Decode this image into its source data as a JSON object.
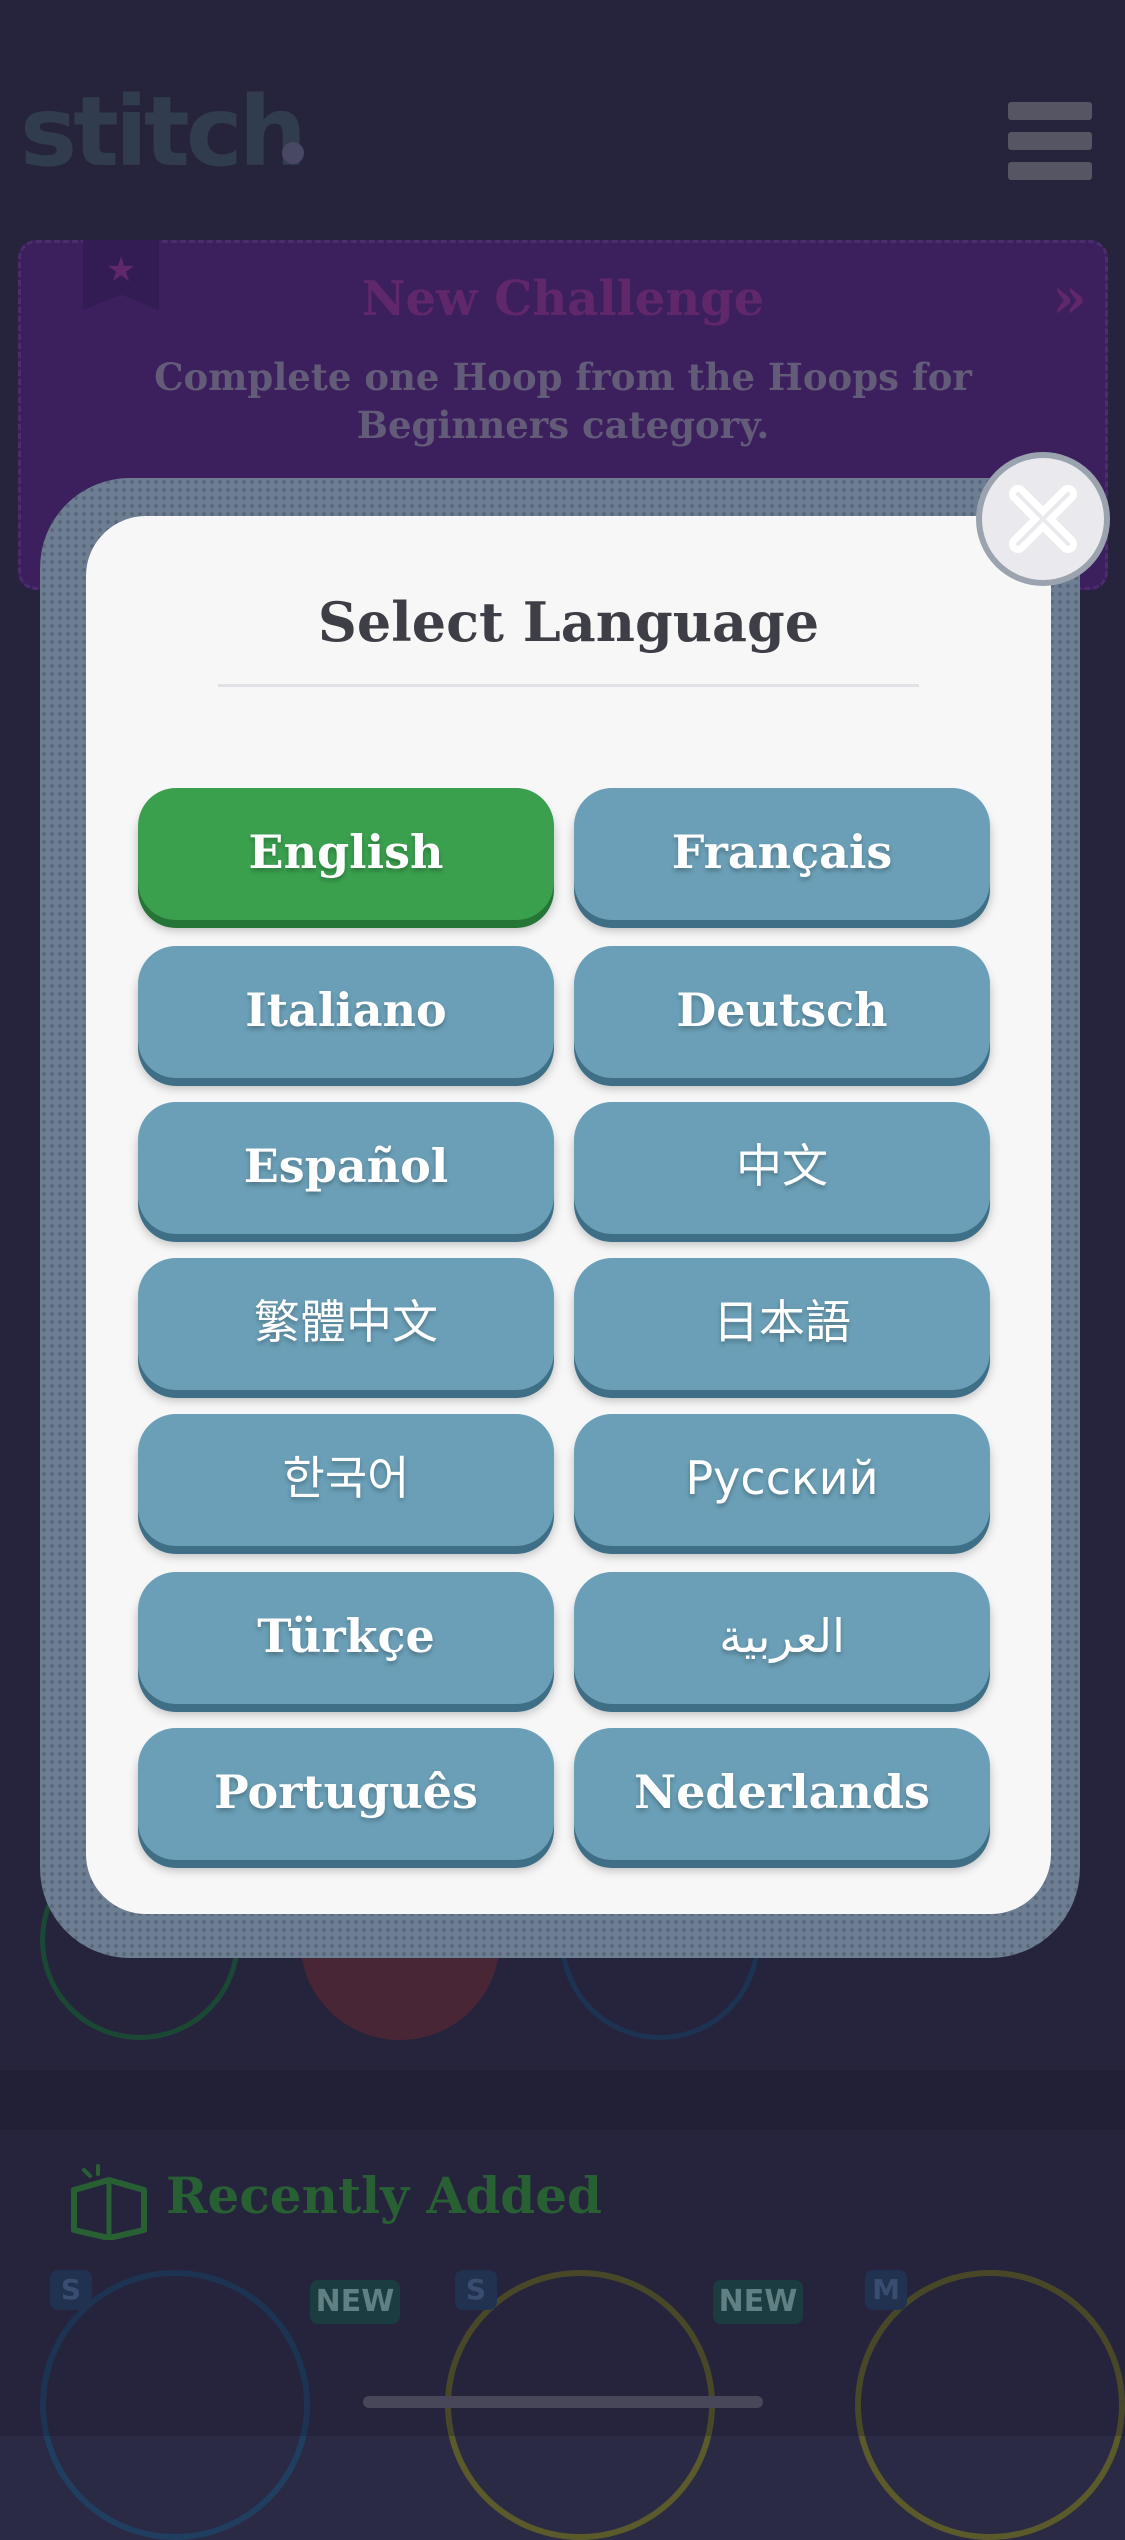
{
  "app": {
    "logo_text": "stitch",
    "menu_icon": "hamburger-menu-icon"
  },
  "challenge": {
    "title": "New Challenge",
    "description": "Complete one Hoop from the Hoops for Beginners category.",
    "ribbon_icon": "star-icon",
    "arrow_icon": "double-chevron-right-icon"
  },
  "recent": {
    "title": "Recently Added",
    "icon": "gift-box-icon",
    "cards": [
      {
        "size": "S",
        "badge": "NEW"
      },
      {
        "size": "S",
        "badge": "NEW"
      },
      {
        "size": "M",
        "badge": ""
      }
    ]
  },
  "modal": {
    "title": "Select Language",
    "close_icon": "close-icon",
    "selected": "English",
    "languages": [
      "English",
      "Français",
      "Italiano",
      "Deutsch",
      "Español",
      "中文",
      "繁體中文",
      "日本語",
      "한국어",
      "Русский",
      "Türkçe",
      "العربية",
      "Português",
      "Nederlands"
    ]
  },
  "colors": {
    "selected": "#3aa04e",
    "button": "#6a9fb7",
    "modal_bg": "#f7f7f8",
    "backdrop": "#2b2a44"
  }
}
